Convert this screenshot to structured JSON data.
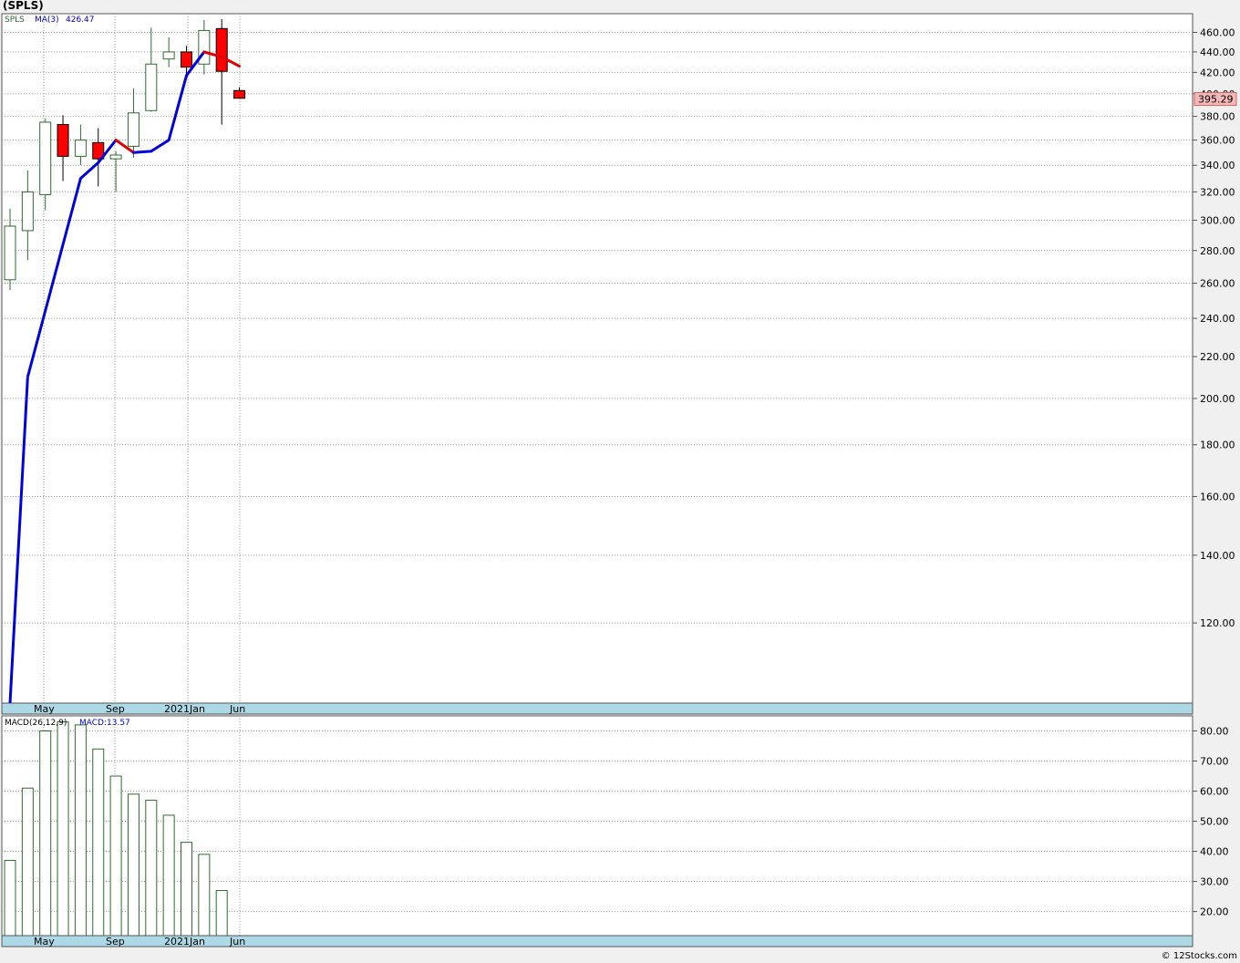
{
  "title": "(SPLS)",
  "footer": "© 12Stocks.com",
  "colors": {
    "up": "#2f6b2f",
    "down_fill": "#ff0000",
    "ma_up": "#0000dd",
    "ma_down": "#dd0000",
    "axis_strip": "#add8e6",
    "macd_bar": "#2f6b2f",
    "last_price_box": "#f4b8b8"
  },
  "price_panel": {
    "legend": {
      "symbol": "SPLS",
      "ma_label": "MA(3)",
      "ma_value": "426.47"
    },
    "last_price": "395.29",
    "y_range": [
      100,
      480
    ],
    "y_scale": "log",
    "y_ticks": [
      "120.00",
      "140.00",
      "160.00",
      "180.00",
      "200.00",
      "220.00",
      "240.00",
      "260.00",
      "280.00",
      "300.00",
      "320.00",
      "340.00",
      "360.00",
      "380.00",
      "400.00",
      "420.00",
      "440.00",
      "460.00"
    ],
    "x_labels": [
      "May",
      "Sep",
      "2021",
      "Jan",
      "Jun"
    ]
  },
  "macd_panel": {
    "legend": {
      "label": "MACD(26,12,9)",
      "value_label": "MACD:13.57"
    },
    "y_range": [
      12,
      85
    ],
    "y_ticks": [
      "20.00",
      "30.00",
      "40.00",
      "50.00",
      "60.00",
      "70.00",
      "80.00"
    ],
    "x_labels": [
      "May",
      "Sep",
      "2021",
      "Jan",
      "Jun"
    ]
  },
  "chart_data": {
    "type": "candlestick",
    "candles": [
      {
        "open": 262,
        "high": 308,
        "low": 256,
        "close": 296
      },
      {
        "open": 293,
        "high": 336,
        "low": 274,
        "close": 320
      },
      {
        "open": 318,
        "high": 378,
        "low": 307,
        "close": 375
      },
      {
        "open": 373,
        "high": 381,
        "low": 328,
        "close": 347
      },
      {
        "open": 347,
        "high": 373,
        "low": 340,
        "close": 360
      },
      {
        "open": 358,
        "high": 370,
        "low": 324,
        "close": 345
      },
      {
        "open": 345,
        "high": 351,
        "low": 320,
        "close": 348
      },
      {
        "open": 355,
        "high": 405,
        "low": 346,
        "close": 383
      },
      {
        "open": 385,
        "high": 465,
        "low": 384,
        "close": 428
      },
      {
        "open": 433,
        "high": 455,
        "low": 425,
        "close": 440
      },
      {
        "open": 440,
        "high": 446,
        "low": 418,
        "close": 425
      },
      {
        "open": 428,
        "high": 473,
        "low": 418,
        "close": 462
      },
      {
        "open": 464,
        "high": 474,
        "low": 373,
        "close": 421
      },
      {
        "open": 403,
        "high": 406,
        "low": 396,
        "close": 396
      }
    ],
    "ma3": [
      null,
      null,
      null,
      null,
      330,
      342,
      360,
      350,
      351,
      360,
      417,
      440,
      435,
      426
    ],
    "macd": [
      37,
      61,
      80,
      83,
      82,
      74,
      65,
      59,
      57,
      52,
      43,
      39,
      27
    ]
  }
}
